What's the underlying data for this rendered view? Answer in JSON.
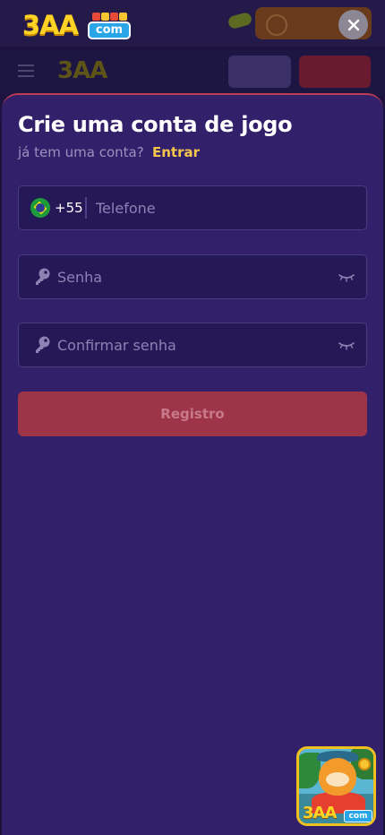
{
  "brand": {
    "logo_text": "3AA",
    "logo_suffix": "com"
  },
  "modal": {
    "title": "Crie uma conta de jogo",
    "subtitle": "já tem uma conta?",
    "login_link": "Entrar",
    "phone": {
      "country_flag": "brazil-flag-icon",
      "dial_code": "+55",
      "placeholder": "Telefone",
      "value": ""
    },
    "password": {
      "placeholder": "Senha",
      "value": ""
    },
    "confirm_password": {
      "placeholder": "Confirmar senha",
      "value": ""
    },
    "submit_label": "Registro"
  },
  "mascot": {
    "logo_text": "3AA",
    "logo_suffix": "com"
  },
  "colors": {
    "sheet_background": "#33206a",
    "field_background": "#251857",
    "accent_link": "#f5c64b",
    "register_button": "#9e3448",
    "logo_yellow": "#ffd426",
    "logo_blue": "#2aa6e8"
  },
  "icons": {
    "close": "close-icon",
    "password_field": "key-icon",
    "password_visibility": "eye-closed-icon"
  }
}
